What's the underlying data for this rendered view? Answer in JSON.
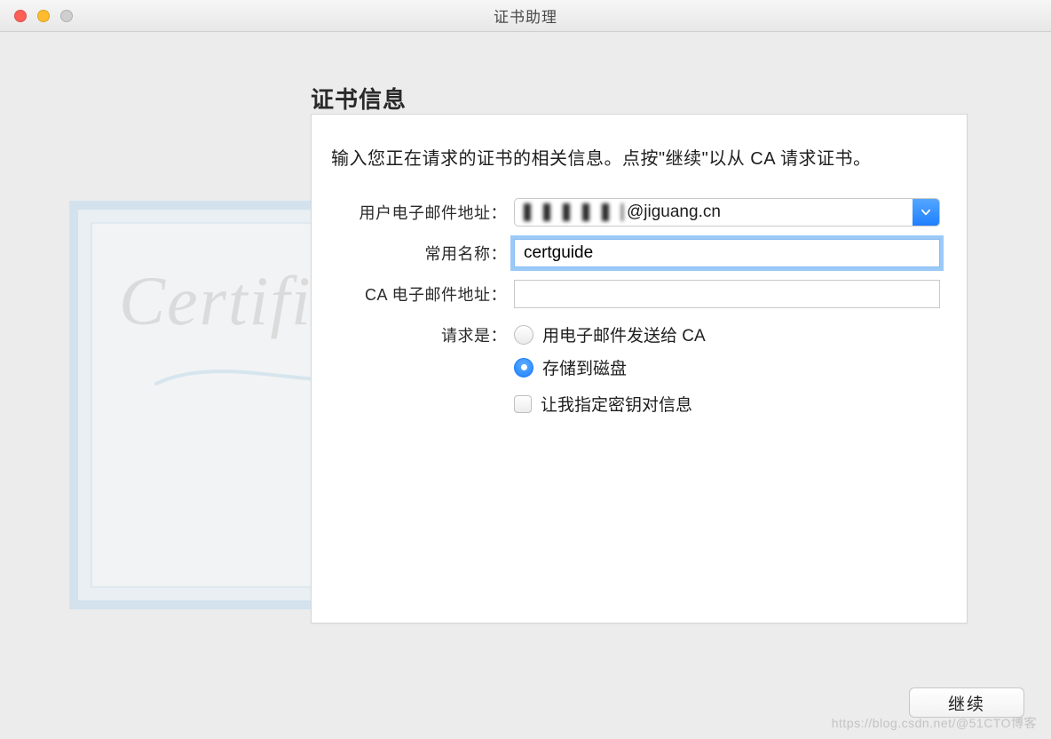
{
  "window": {
    "title": "证书助理"
  },
  "heading": "证书信息",
  "intro": "输入您正在请求的证书的相关信息。点按\"继续\"以从 CA 请求证书。",
  "fields": {
    "email": {
      "label": "用户电子邮件地址：",
      "value_suffix": "@jiguang.cn"
    },
    "common_name": {
      "label": "常用名称：",
      "value": "certguide"
    },
    "ca_email": {
      "label": "CA 电子邮件地址：",
      "value": ""
    },
    "request": {
      "label": "请求是："
    }
  },
  "options": {
    "email_ca": {
      "label": "用电子邮件发送给 CA",
      "selected": false
    },
    "save_disk": {
      "label": "存储到磁盘",
      "selected": true
    },
    "keypair": {
      "label": "让我指定密钥对信息",
      "checked": false
    }
  },
  "buttons": {
    "continue": "继续"
  },
  "colors": {
    "accent": "#1f7fff",
    "focus_ring": "#9bcaf8"
  },
  "watermark": "https://blog.csdn.net/@51CTO博客"
}
